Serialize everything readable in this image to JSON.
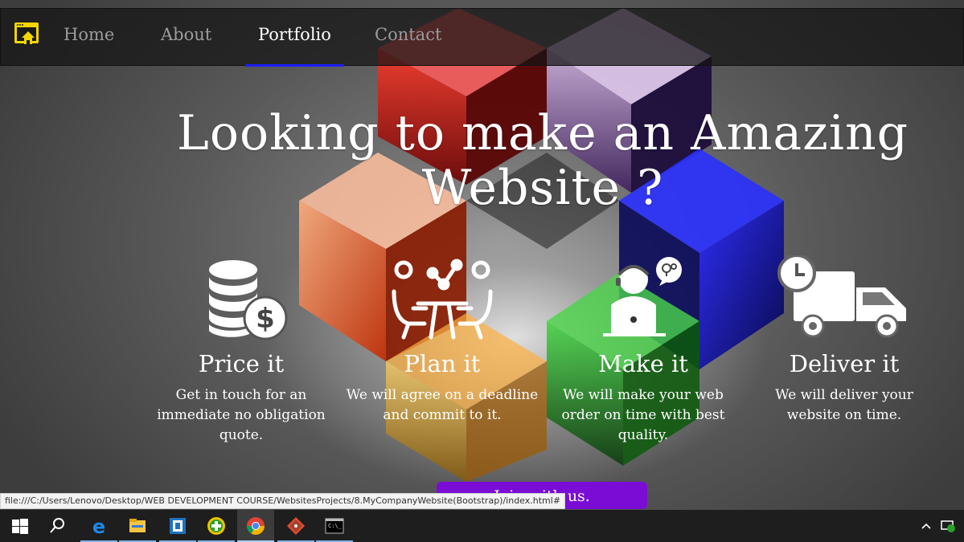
{
  "nav": {
    "items": [
      {
        "label": "Home",
        "active": false
      },
      {
        "label": "About",
        "active": false
      },
      {
        "label": "Portfolio",
        "active": true
      },
      {
        "label": "Contact",
        "active": false
      }
    ],
    "brand_icon": "home-window-icon"
  },
  "hero": {
    "title": "Looking to make an Amazing Website ?"
  },
  "features": [
    {
      "icon": "coins-dollar-icon",
      "title": "Price it",
      "text": "Get in touch for an immediate no obligation quote."
    },
    {
      "icon": "meeting-table-icon",
      "title": "Plan it",
      "text": "We will agree on a deadline and commit to it."
    },
    {
      "icon": "developer-laptop-icon",
      "title": "Make it",
      "text": "We will make your web order on time with best quality."
    },
    {
      "icon": "delivery-truck-icon",
      "title": "Deliver it",
      "text": "We will deliver your website on time."
    }
  ],
  "cta": {
    "label": "Join with us."
  },
  "status_url": "file:///C:/Users/Lenovo/Desktop/WEB DEVELOPMENT COURSE/WebsitesProjects/8.MyCompanyWebsite(Bootstrap)/index.html#",
  "taskbar": {
    "apps": [
      "start-icon",
      "search-icon",
      "edge-icon",
      "file-explorer-icon",
      "store-app-icon",
      "green-plus-app-icon",
      "chrome-icon",
      "git-icon",
      "terminal-icon"
    ],
    "tray": [
      "chevron-up-icon",
      "network-icon"
    ]
  },
  "colors": {
    "active_underline": "#1d1dff",
    "cta": "#7a0cd6",
    "brand_icon": "#f2d600"
  }
}
